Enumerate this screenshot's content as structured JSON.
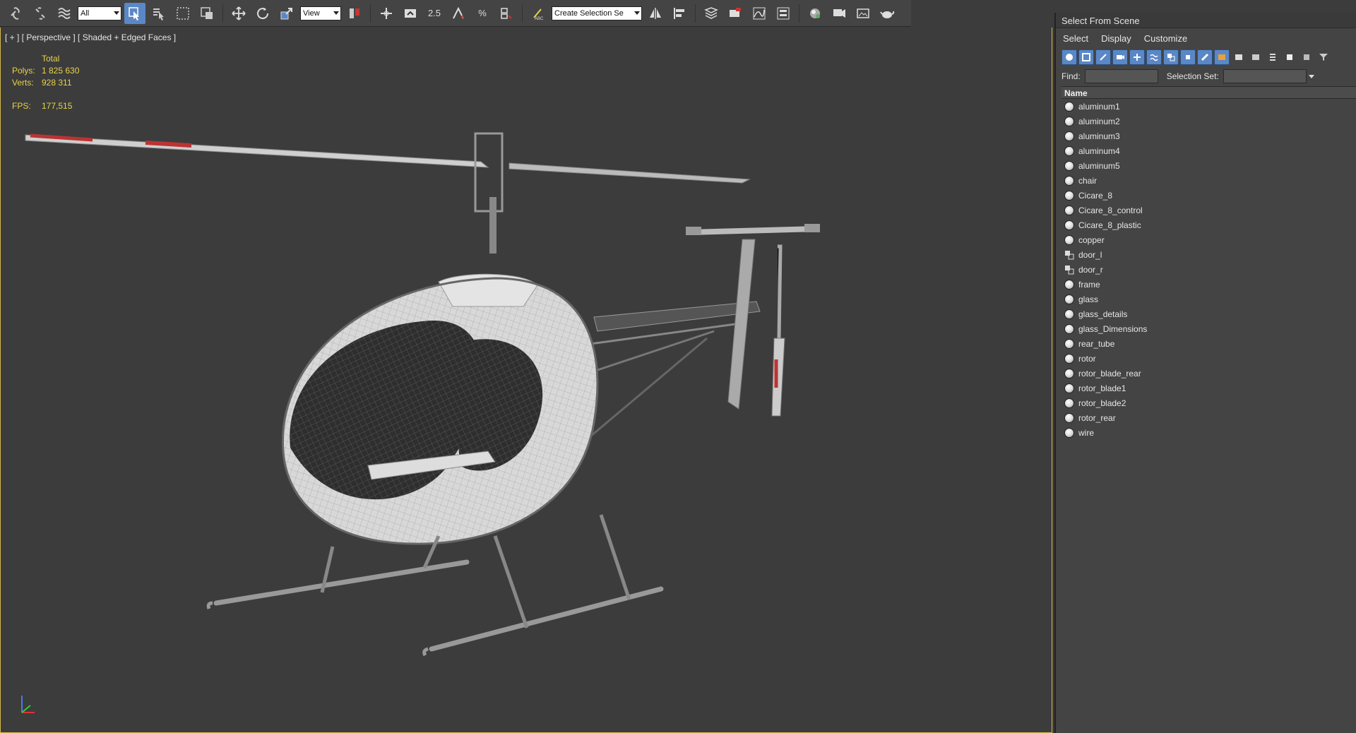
{
  "toolbar": {
    "selection_filter": "All",
    "ref_coord": "View",
    "snap_label": "2.5",
    "named_selection_placeholder": "Create Selection Se"
  },
  "viewport": {
    "label": "[ + ] [ Perspective ] [ Shaded + Edged Faces ]",
    "stats": {
      "total_label": "Total",
      "polys_label": "Polys:",
      "polys_value": "1 825 630",
      "verts_label": "Verts:",
      "verts_value": "928 311",
      "fps_label": "FPS:",
      "fps_value": "177,515"
    }
  },
  "panel": {
    "title": "Select From Scene",
    "menu": [
      "Select",
      "Display",
      "Customize"
    ],
    "find_label": "Find:",
    "selection_set_label": "Selection Set:",
    "column_header": "Name",
    "items": [
      {
        "name": "aluminum1",
        "icon": "sphere-icon"
      },
      {
        "name": "aluminum2",
        "icon": "sphere-icon"
      },
      {
        "name": "aluminum3",
        "icon": "sphere-icon"
      },
      {
        "name": "aluminum4",
        "icon": "sphere-icon"
      },
      {
        "name": "aluminum5",
        "icon": "sphere-icon"
      },
      {
        "name": "chair",
        "icon": "sphere-icon"
      },
      {
        "name": "Cicare_8",
        "icon": "sphere-icon"
      },
      {
        "name": "Cicare_8_control",
        "icon": "sphere-icon"
      },
      {
        "name": "Cicare_8_plastic",
        "icon": "sphere-icon"
      },
      {
        "name": "copper",
        "icon": "sphere-icon"
      },
      {
        "name": "door_l",
        "icon": "group-icon"
      },
      {
        "name": "door_r",
        "icon": "group-icon"
      },
      {
        "name": "frame",
        "icon": "sphere-icon"
      },
      {
        "name": "glass",
        "icon": "sphere-icon"
      },
      {
        "name": "glass_details",
        "icon": "sphere-icon"
      },
      {
        "name": "glass_Dimensions",
        "icon": "sphere-icon"
      },
      {
        "name": "rear_tube",
        "icon": "sphere-icon"
      },
      {
        "name": "rotor",
        "icon": "sphere-icon"
      },
      {
        "name": "rotor_blade_rear",
        "icon": "sphere-icon"
      },
      {
        "name": "rotor_blade1",
        "icon": "sphere-icon"
      },
      {
        "name": "rotor_blade2",
        "icon": "sphere-icon"
      },
      {
        "name": "rotor_rear",
        "icon": "sphere-icon"
      },
      {
        "name": "wire",
        "icon": "sphere-icon"
      }
    ]
  },
  "colors": {
    "viewport_bg": "#3c3c3c",
    "stats_text": "#e8d24a",
    "active_border": "#d8b84a",
    "accent": "#5a87c6"
  }
}
